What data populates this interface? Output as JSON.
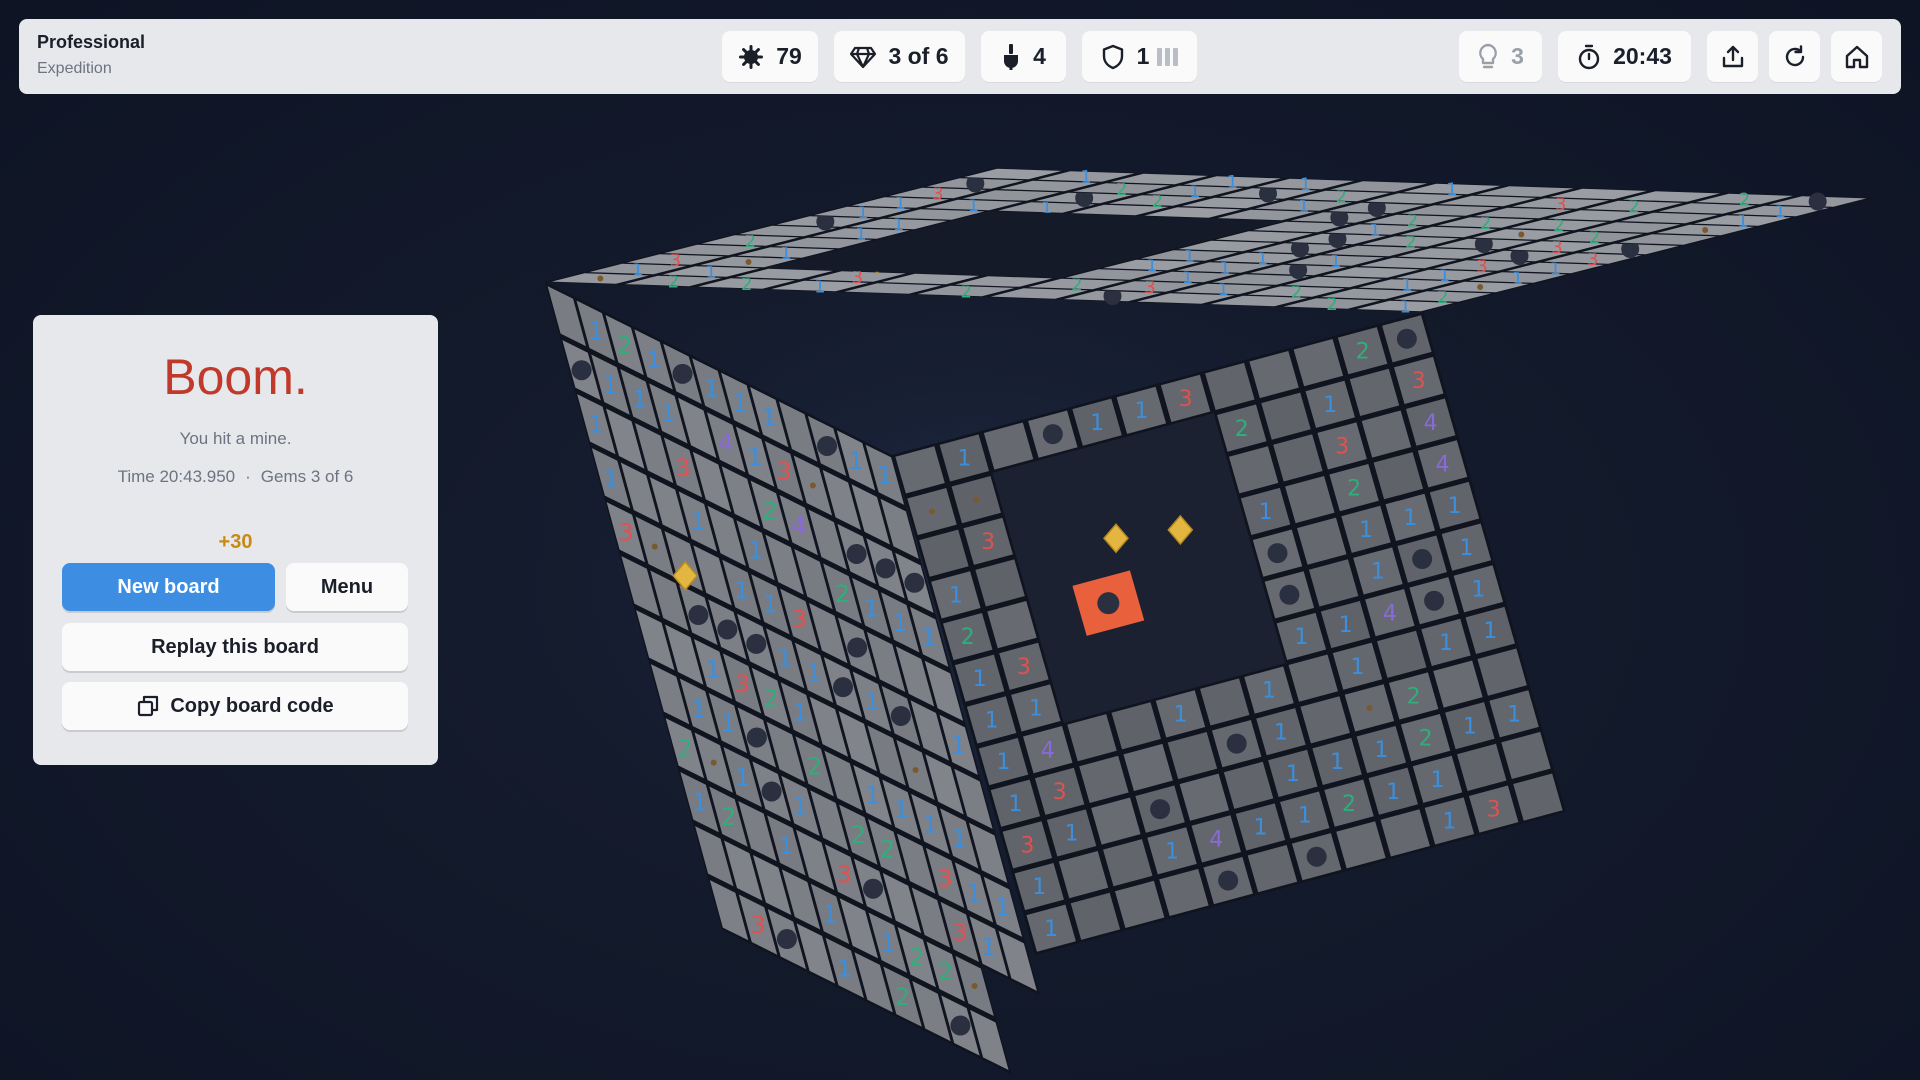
{
  "header": {
    "mode_title": "Professional",
    "mode_subtitle": "Expedition",
    "mines": "79",
    "gems": "3 of 6",
    "flags": "4",
    "shields": "1",
    "hints": "3",
    "timer": "20:43"
  },
  "icons": {
    "mines": "mine-icon",
    "gems": "gem-icon",
    "flags": "flag-icon",
    "shields": "shield-icon",
    "hints": "lightbulb-icon",
    "timer": "stopwatch-icon",
    "share": "share-icon",
    "restart": "restart-icon",
    "home": "home-icon"
  },
  "result": {
    "title": "Boom.",
    "message": "You hit a mine.",
    "time": "Time 20:43.950",
    "separator": "·",
    "gems": "Gems 3 of 6",
    "bonus": "+30",
    "new_board": "New board",
    "menu": "Menu",
    "replay": "Replay this board",
    "copy_code": "Copy board code"
  },
  "colors": {
    "accent": "#3d8ee2",
    "boom": "#c0392b",
    "bonus": "#c98a14",
    "exploded_mine": "#e8603c",
    "gem": "#e2b640",
    "num1": "#3b8fdc",
    "num2": "#2fae7a",
    "num3": "#e0524f",
    "num4": "#8a6ad8"
  }
}
